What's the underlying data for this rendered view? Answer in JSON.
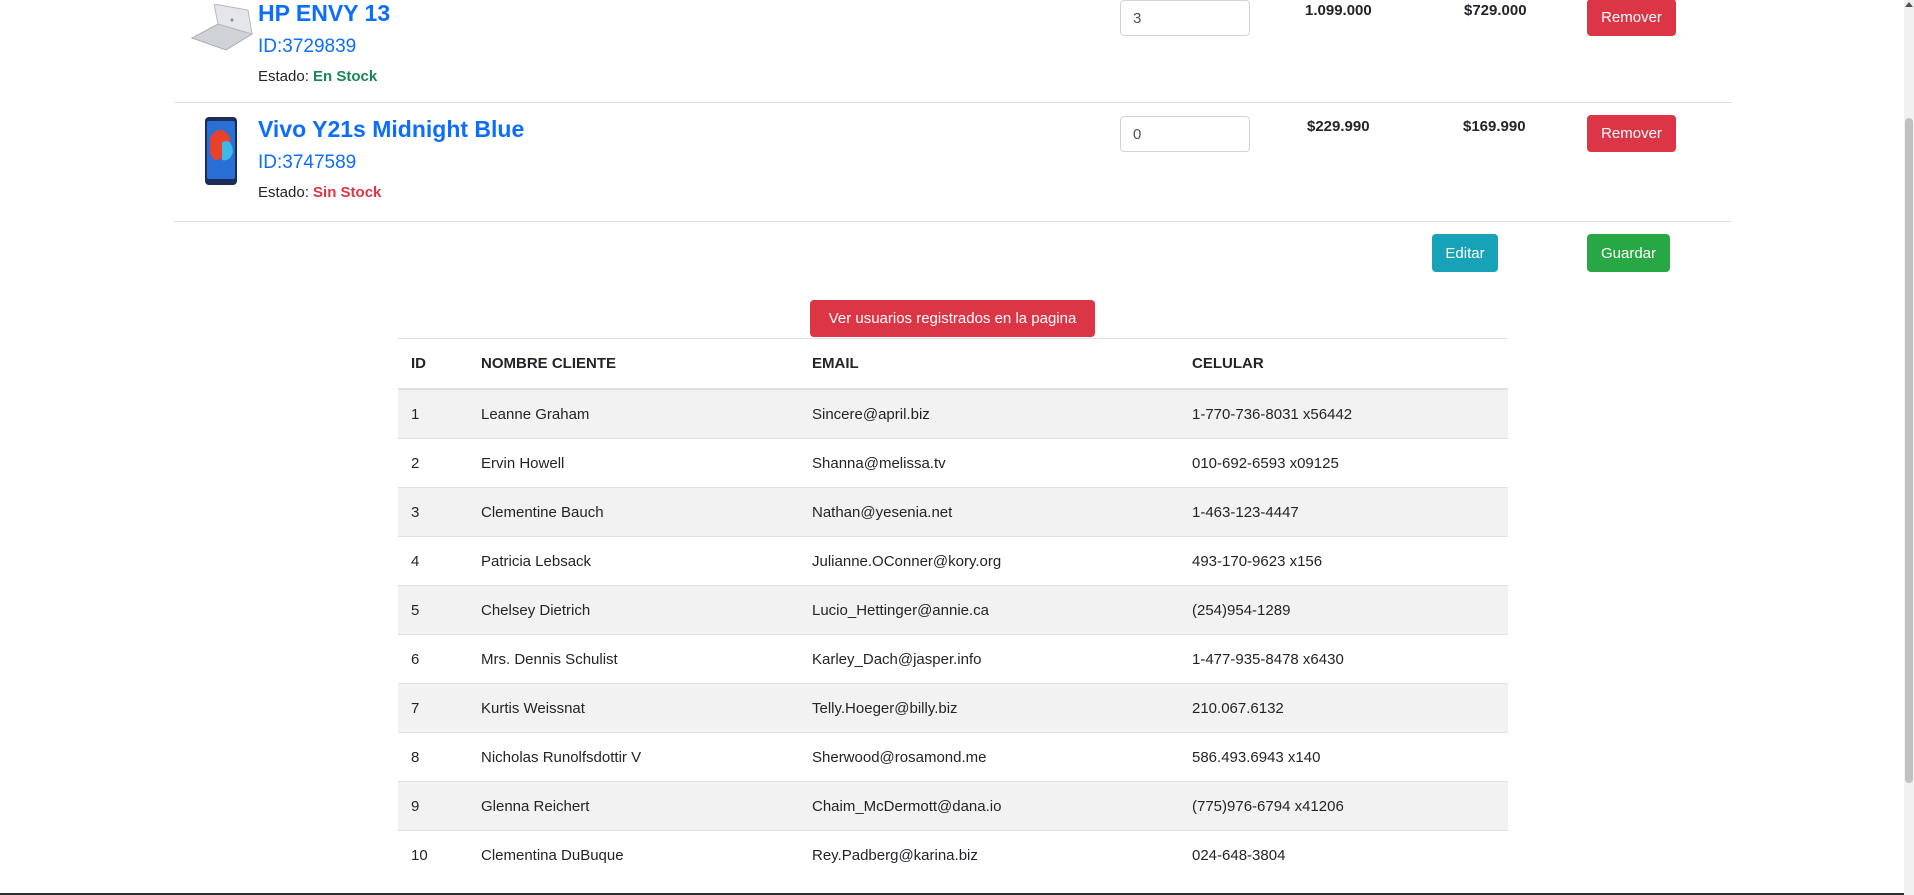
{
  "cart": {
    "items": [
      {
        "title": "HP ENVY 13",
        "id_text": "ID:3729839",
        "status_label": "Estado:",
        "status_value": "En Stock",
        "quantity": "3",
        "price_normal": "1.099.000",
        "price_offer": "$729.000",
        "remove_label": "Remover"
      },
      {
        "title": "Vivo Y21s Midnight Blue",
        "id_text": "ID:3747589",
        "status_label": "Estado:",
        "status_value": "Sin Stock",
        "quantity": "0",
        "price_normal": "$229.990",
        "price_offer": "$169.990",
        "remove_label": "Remover"
      }
    ],
    "edit_label": "Editar",
    "save_label": "Guardar"
  },
  "users": {
    "button_label": "Ver usuarios registrados en la pagina",
    "columns": [
      "ID",
      "NOMBRE CLIENTE",
      "EMAIL",
      "CELULAR"
    ],
    "rows": [
      [
        "1",
        "Leanne Graham",
        "Sincere@april.biz",
        "1-770-736-8031 x56442"
      ],
      [
        "2",
        "Ervin Howell",
        "Shanna@melissa.tv",
        "010-692-6593 x09125"
      ],
      [
        "3",
        "Clementine Bauch",
        "Nathan@yesenia.net",
        "1-463-123-4447"
      ],
      [
        "4",
        "Patricia Lebsack",
        "Julianne.OConner@kory.org",
        "493-170-9623 x156"
      ],
      [
        "5",
        "Chelsey Dietrich",
        "Lucio_Hettinger@annie.ca",
        "(254)954-1289"
      ],
      [
        "6",
        "Mrs. Dennis Schulist",
        "Karley_Dach@jasper.info",
        "1-477-935-8478 x6430"
      ],
      [
        "7",
        "Kurtis Weissnat",
        "Telly.Hoeger@billy.biz",
        "210.067.6132"
      ],
      [
        "8",
        "Nicholas Runolfsdottir V",
        "Sherwood@rosamond.me",
        "586.493.6943 x140"
      ],
      [
        "9",
        "Glenna Reichert",
        "Chaim_McDermott@dana.io",
        "(775)976-6794 x41206"
      ],
      [
        "10",
        "Clementina DuBuque",
        "Rey.Padberg@karina.biz",
        "024-648-3804"
      ]
    ]
  },
  "colors": {
    "link": "#0d6efd",
    "danger": "#dc3545",
    "info": "#17a2b8",
    "success": "#28a745",
    "in_stock": "#198754"
  }
}
